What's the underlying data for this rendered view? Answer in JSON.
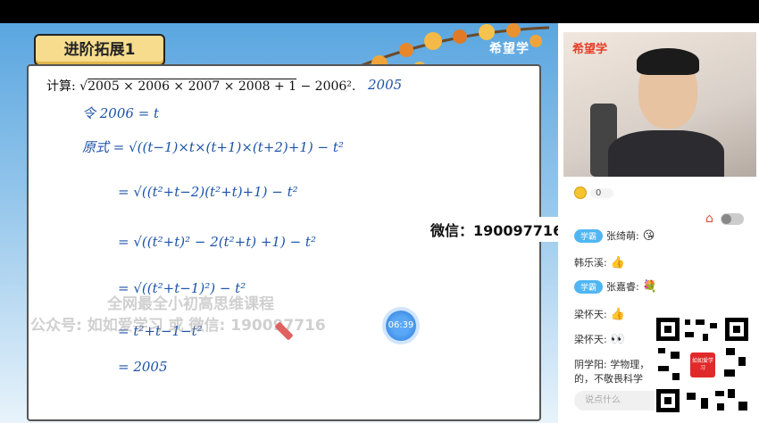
{
  "slide": {
    "title": "进阶拓展1",
    "brand": "希望学",
    "problem_prefix": "计算:",
    "problem_radical": "2005 × 2006 × 2007 × 2008 + 1",
    "problem_suffix": " − 2006².",
    "answer": "2005",
    "work_lines": [
      "令 2006 = t",
      "原式 = √((t−1)×t×(t+1)×(t+2)+1)   − t²",
      "= √((t²+t−2)(t²+t)+1)  − t²",
      "= √((t²+t)² − 2(t²+t) +1)  − t²",
      "= √((t²+t−1)²)  − t²",
      "= t²+t−1−t²",
      "= 2005"
    ],
    "timer": "06:39",
    "wechat": "微信：190097716",
    "watermark_1": "全网最全小初高思维课程",
    "watermark_2": "公众号: 如如爱学习 或 微信: 190097716"
  },
  "sidebar": {
    "camera_brand": "希望学",
    "coin_count": "0",
    "chat": [
      {
        "badge": "学霸",
        "name": "张绮萌:",
        "emoji": "😘"
      },
      {
        "badge": "",
        "name": "韩乐溪:",
        "emoji": "👍"
      },
      {
        "badge": "学霸",
        "name": "张嘉睿:",
        "emoji": "💐"
      },
      {
        "badge": "",
        "name": "梁怀天:",
        "emoji": "👍"
      },
      {
        "badge": "",
        "name": "梁怀天:",
        "emoji": "👀"
      },
      {
        "badge": "",
        "name": "阴学阳: 学物理，",
        "emoji": ""
      },
      {
        "badge": "",
        "name": "的，不敬畏科学",
        "emoji": ""
      }
    ],
    "input_placeholder": "说点什么",
    "qr_label": "如如爱学习"
  }
}
